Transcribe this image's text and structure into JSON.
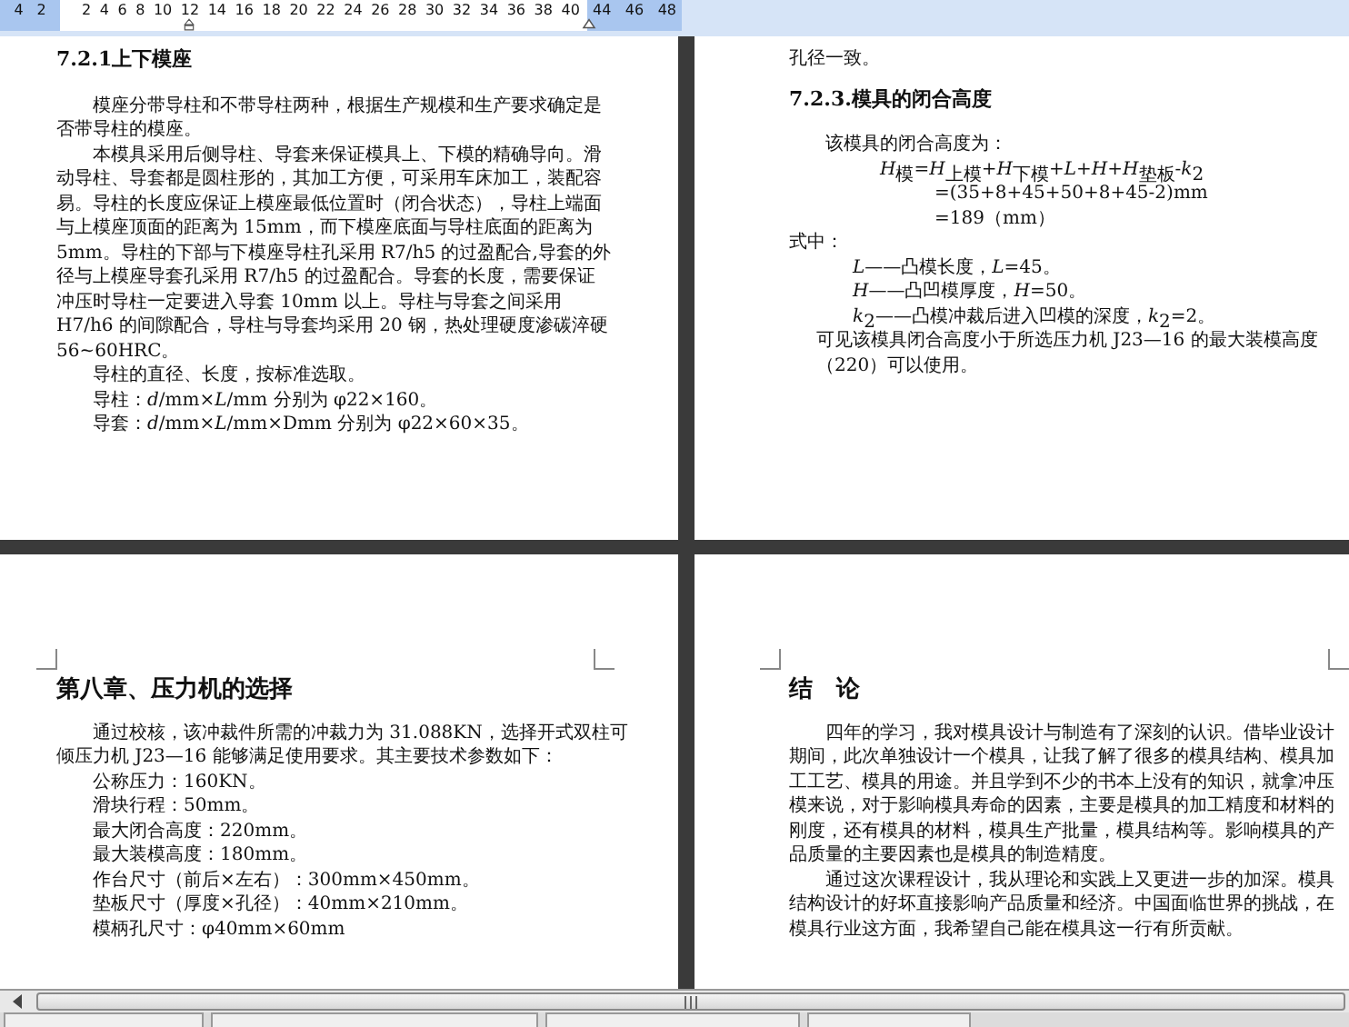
{
  "ruler": {
    "left_numbers": [
      "4",
      "2"
    ],
    "numbers": [
      "2",
      "4",
      "6",
      "8",
      "10",
      "12",
      "14",
      "16",
      "18",
      "20",
      "22",
      "24",
      "26",
      "28",
      "30",
      "32",
      "34",
      "36",
      "38",
      "40"
    ],
    "right_numbers": [
      "44",
      "46",
      "48"
    ]
  },
  "pages": [
    {
      "blocks": [
        {
          "kind": "heading",
          "text": "7.2.1上下模座"
        },
        {
          "kind": "para",
          "text": "模座分带导柱和不带导柱两种，根据生产规模和生产要求确定是否带导柱的模座。"
        },
        {
          "kind": "para",
          "text": "本模具采用后侧导柱、导套来保证模具上、下模的精确导向。滑动导柱、导套都是圆柱形的，其加工方便，可采用车床加工，装配容易。导柱的长度应保证上模座最低位置时（闭合状态），导柱上端面与上模座顶面的距离为 15mm，而下模座底面与导柱底面的距离为 5mm。导柱的下部与下模座导柱孔采用 R7/h5 的过盈配合,导套的外径与上模座导套孔采用 R7/h5 的过盈配合。导套的长度，需要保证冲压时导柱一定要进入导套 10mm 以上。导柱与导套之间采用 H7/h6 的间隙配合，导柱与导套均采用 20 钢，热处理硬度渗碳淬硬 56~60HRC。"
        },
        {
          "kind": "item",
          "text": "导柱的直径、长度，按标准选取。"
        },
        {
          "kind": "item",
          "text": "导柱：*d*/mm×*L*/mm 分别为 φ22×160。"
        },
        {
          "kind": "item",
          "text": "导套：*d*/mm×*L*/mm×Dmm 分别为 φ22×60×35。"
        }
      ]
    },
    {
      "blocks": [
        {
          "kind": "text",
          "text": "孔径一致。"
        },
        {
          "kind": "heading",
          "text": "7.2.3.模具的闭合高度"
        },
        {
          "kind": "item",
          "text": "该模具的闭合高度为："
        },
        {
          "kind": "formula",
          "text": "*H*$_{模}$=*H*$_{上模}$+*H*$_{下模}$+*L*+*H*+*H*$_{垫板}$-*k*$_{2}$"
        },
        {
          "kind": "result",
          "text": "=(35+8+45+50+8+45-2)mm"
        },
        {
          "kind": "result",
          "text": "=189（mm）"
        },
        {
          "kind": "text",
          "text": "式中："
        },
        {
          "kind": "definition",
          "text": "*L*——凸模长度，*L*=45。"
        },
        {
          "kind": "definition",
          "text": "*H*——凸凹模厚度，*H*=50。"
        },
        {
          "kind": "definition",
          "text": "*k*$_{2}$——凸模冲裁后进入凹模的深度，*k*$_{2}$=2。"
        },
        {
          "kind": "note",
          "text": "可见该模具闭合高度小于所选压力机 J23—16 的最大装模高度（220）可以使用。"
        }
      ]
    },
    {
      "blocks": [
        {
          "kind": "chapter",
          "text": "第八章、压力机的选择"
        },
        {
          "kind": "para",
          "text": "通过校核，该冲裁件所需的冲裁力为 31.088KN，选择开式双柱可倾压力机 J23—16 能够满足使用要求。其主要技术参数如下："
        },
        {
          "kind": "item",
          "text": "公称压力：160KN。"
        },
        {
          "kind": "item",
          "text": "滑块行程：50mm。"
        },
        {
          "kind": "item",
          "text": "最大闭合高度：220mm。"
        },
        {
          "kind": "item",
          "text": "最大装模高度：180mm。"
        },
        {
          "kind": "item",
          "text": "作台尺寸（前后×左右）：300mm×450mm。"
        },
        {
          "kind": "item",
          "text": "垫板尺寸（厚度×孔径）：40mm×210mm。"
        },
        {
          "kind": "item",
          "text": "模柄孔尺寸：φ40mm×60mm"
        }
      ]
    },
    {
      "blocks": [
        {
          "kind": "chapter",
          "text": "结　论"
        },
        {
          "kind": "para",
          "text": "四年的学习，我对模具设计与制造有了深刻的认识。借毕业设计期间，此次单独设计一个模具，让我了解了很多的模具结构、模具加工工艺、模具的用途。并且学到不少的书本上没有的知识，就拿冲压模来说，对于影响模具寿命的因素，主要是模具的加工精度和材料的刚度，还有模具的材料，模具生产批量，模具结构等。影响模具的产品质量的主要因素也是模具的制造精度。"
        },
        {
          "kind": "para",
          "text": "通过这次课程设计，我从理论和实践上又更进一步的加深。模具结构设计的好坏直接影响产品质量和经济。中国面临世界的挑战，在模具行业这方面，我希望自己能在模具这一行有所贡献。"
        }
      ]
    }
  ]
}
